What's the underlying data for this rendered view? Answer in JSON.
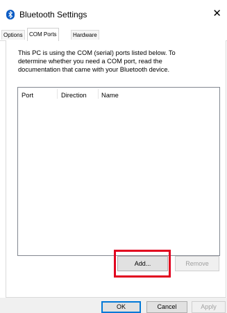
{
  "window": {
    "title": "Bluetooth Settings",
    "close_glyph": "✕"
  },
  "tabs": [
    {
      "label": "Options"
    },
    {
      "label": "COM Ports"
    },
    {
      "label": "Hardware"
    }
  ],
  "comports": {
    "description": "This PC is using the COM (serial) ports listed below. To determine whether you need a COM port, read the documentation that came with your Bluetooth device.",
    "columns": [
      "Port",
      "Direction",
      "Name"
    ],
    "rows": [],
    "add_label": "Add...",
    "remove_label": "Remove"
  },
  "footer": {
    "ok_label": "OK",
    "cancel_label": "Cancel",
    "apply_label": "Apply"
  },
  "colors": {
    "accent": "#0078d7",
    "bluetooth_icon": "#0a5bc4",
    "highlight": "#e1001e"
  }
}
